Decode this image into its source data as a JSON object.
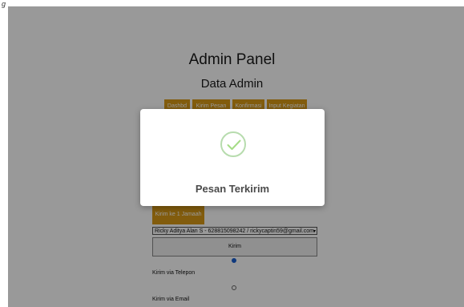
{
  "corner_label": "g",
  "header": {
    "title": "Admin Panel",
    "subtitle": "Data Admin"
  },
  "tabs": [
    {
      "label": "Dashbd"
    },
    {
      "label": "Kirim Pesan"
    },
    {
      "label": "Konfirmasi"
    },
    {
      "label": "Input Kegiatan"
    }
  ],
  "send": {
    "button_label": "Kirim ke 1 Jamaah",
    "select_value": "Ricky Aditya Alan S - 628815098242 / rickycaptin59@gmail.com",
    "kirim_label": "Kirim"
  },
  "radios": [
    {
      "label": "Kirim via Telepon",
      "checked": true
    },
    {
      "label": "Kirim via Email",
      "checked": false
    }
  ],
  "modal": {
    "message": "Pesan Terkirim",
    "icon": "check-icon"
  },
  "colors": {
    "accent": "#d99a16",
    "overlay": "#000000",
    "success": "#a5dc86"
  }
}
